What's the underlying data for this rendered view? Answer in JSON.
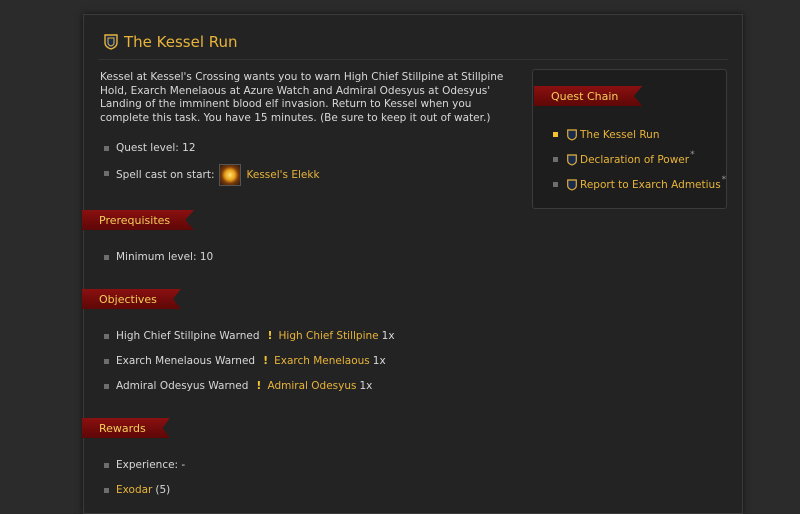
{
  "quest": {
    "title": "The Kessel Run",
    "description": "Kessel at Kessel's Crossing wants you to warn High Chief Stillpine at Stillpine Hold, Exarch Menelaous at Azure Watch and Admiral Odesyus at Odesyus' Landing of the imminent blood elf invasion. Return to Kessel when you complete this task. You have 15 minutes. (Be sure to keep it out of water.)",
    "level_text": "Quest level: 12",
    "spell_label": "Spell cast on start:",
    "spell_name": "Kessel's Elekk"
  },
  "prerequisites": {
    "header": "Prerequisites",
    "min_level_text": "Minimum level: 10"
  },
  "objectives": {
    "header": "Objectives",
    "items": [
      {
        "label": "High Chief Stillpine Warned",
        "target": "High Chief Stillpine",
        "count": "1x"
      },
      {
        "label": "Exarch Menelaous Warned",
        "target": "Exarch Menelaous",
        "count": "1x"
      },
      {
        "label": "Admiral Odesyus Warned",
        "target": "Admiral Odesyus",
        "count": "1x"
      }
    ]
  },
  "rewards": {
    "header": "Rewards",
    "experience_text": "Experience: -",
    "reputation": {
      "faction": "Exodar",
      "amount": "(5)"
    }
  },
  "quest_chain": {
    "header": "Quest Chain",
    "items": [
      {
        "label": "The Kessel Run",
        "star": ""
      },
      {
        "label": "Declaration of Power",
        "star": "*"
      },
      {
        "label": "Report to Exarch Admetius",
        "star": "*"
      }
    ]
  },
  "icons": {
    "quest": "alliance-shield-icon",
    "objective": "exclamation-icon",
    "spell": "fire-burst-icon"
  },
  "colors": {
    "link": "#e8b43a",
    "banner": "#7a0c0c",
    "background": "#2b2b2b"
  }
}
